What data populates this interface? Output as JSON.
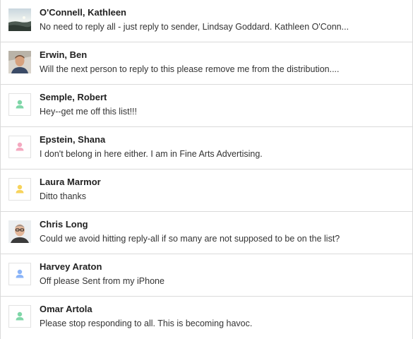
{
  "messages": [
    {
      "sender": "O'Connell, Kathleen",
      "snippet": "No need to reply all - just reply to sender, Lindsay Goddard. Kathleen O'Conn...",
      "avatar": {
        "type": "photo",
        "icon": "landscape-photo-avatar"
      }
    },
    {
      "sender": "Erwin, Ben",
      "snippet": "Will the next person to reply to this please remove me from the distribution....",
      "avatar": {
        "type": "photo",
        "icon": "person-photo-avatar"
      }
    },
    {
      "sender": "Semple, Robert",
      "snippet": "Hey--get me off this list!!!",
      "avatar": {
        "type": "default",
        "color": "#7fd6a8",
        "icon": "person-icon"
      }
    },
    {
      "sender": "Epstein, Shana",
      "snippet": "I don't belong in here either. I am in Fine Arts Advertising.",
      "avatar": {
        "type": "default",
        "color": "#f4a9c0",
        "icon": "person-icon"
      }
    },
    {
      "sender": "Laura Marmor",
      "snippet": "Ditto thanks",
      "avatar": {
        "type": "default",
        "color": "#f7d35b",
        "icon": "person-icon"
      }
    },
    {
      "sender": "Chris Long",
      "snippet": "Could we avoid hitting reply-all if so many are not supposed to be on the list?",
      "avatar": {
        "type": "photo",
        "icon": "person-photo-avatar"
      }
    },
    {
      "sender": "Harvey Araton",
      "snippet": "Off please Sent from my iPhone",
      "avatar": {
        "type": "default",
        "color": "#8ab4f8",
        "icon": "person-icon"
      }
    },
    {
      "sender": "Omar Artola",
      "snippet": "Please stop responding to all. This is becoming havoc.",
      "avatar": {
        "type": "default",
        "color": "#7fd6a8",
        "icon": "person-icon"
      }
    }
  ]
}
